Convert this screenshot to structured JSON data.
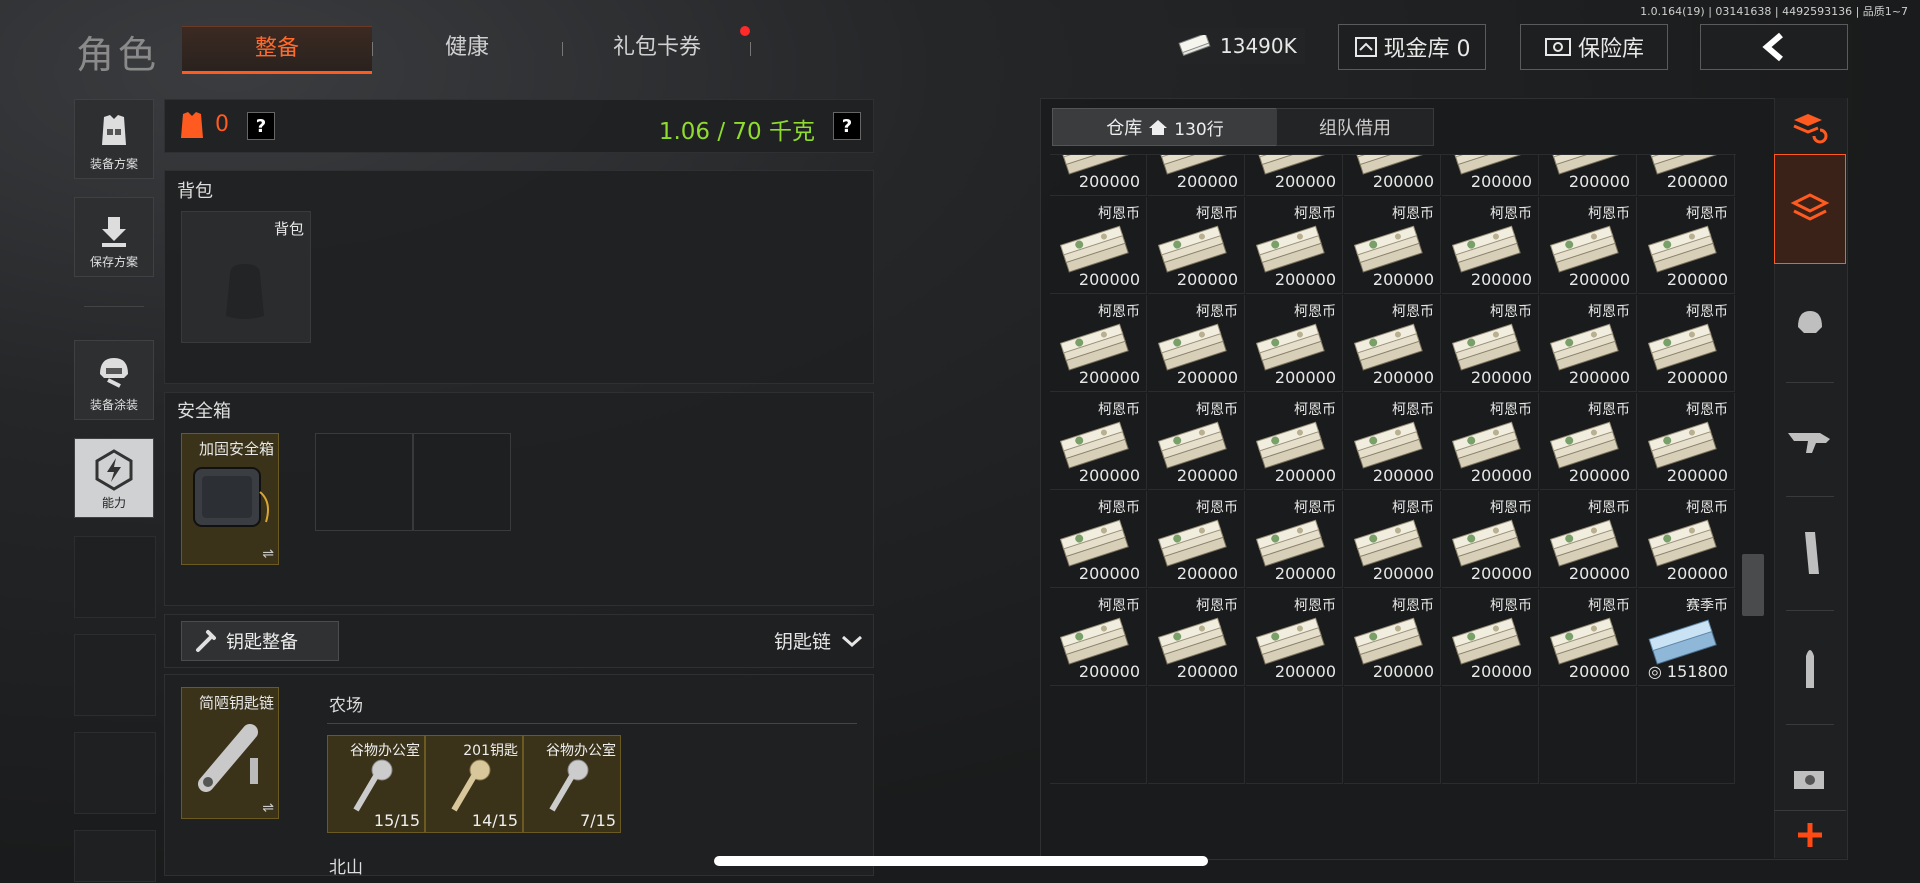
{
  "version": "1.0.164(19) | 03141638 | 4492593136 | 品质1~7",
  "title": "角色",
  "tabs": [
    {
      "label": "整备",
      "active": true
    },
    {
      "label": "健康",
      "active": false
    },
    {
      "label": "礼包卡券",
      "active": false
    }
  ],
  "money": "13490K",
  "cash_vault_label": "现金库 0",
  "safe_label": "保险库",
  "rail": [
    {
      "label": "装备方案",
      "icon": "vest-icon"
    },
    {
      "label": "保存方案",
      "icon": "download-icon"
    },
    {
      "label": "装备涂装",
      "icon": "helmet-icon"
    },
    {
      "label": "能力",
      "icon": "lightning-icon"
    }
  ],
  "loadout": {
    "armor_count": "0",
    "weight": "1.06 / 70 千克",
    "help": "?"
  },
  "backpack": {
    "section": "背包",
    "slot_label": "背包"
  },
  "safebox": {
    "section": "安全箱",
    "item_label": "加固安全箱"
  },
  "keys": {
    "button_label": "钥匙整备",
    "dropdown_label": "钥匙链",
    "chain_label": "简陋钥匙链",
    "region1": "农场",
    "region2": "北山",
    "items": [
      {
        "name": "谷物办公室",
        "count": "15/15"
      },
      {
        "name": "201钥匙",
        "count": "14/15"
      },
      {
        "name": "谷物办公室",
        "count": "7/15"
      }
    ]
  },
  "stash": {
    "tab_warehouse": "仓库",
    "rows": "130行",
    "tab_borrow": "组队借用",
    "item_name": "柯恩币",
    "item_value": "200000",
    "season_name": "赛季币",
    "season_value": "151800"
  },
  "colors": {
    "accent": "#ff5a1f",
    "weight": "#8fdc2f"
  }
}
